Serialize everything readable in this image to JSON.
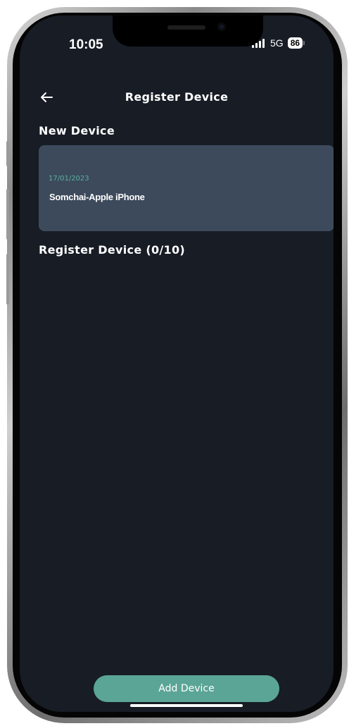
{
  "status_bar": {
    "time": "10:05",
    "network": "5G",
    "battery": "86"
  },
  "header": {
    "back_icon": "arrow-left-icon",
    "title": "Register Device"
  },
  "new_device_section": {
    "title": "New Device",
    "card": {
      "date": "17/01/2023",
      "name": "Somchai-Apple iPhone"
    }
  },
  "registered_section": {
    "title": "Register Device (0/10)"
  },
  "footer": {
    "add_button_label": "Add Device"
  },
  "colors": {
    "background": "#171c25",
    "card": "#3c4a5c",
    "accent": "#5ba597",
    "date_text": "#5bb09a"
  }
}
